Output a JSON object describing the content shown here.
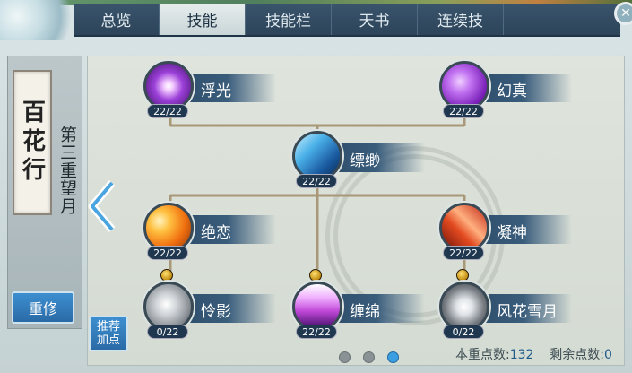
{
  "tabs": [
    {
      "label": "总览",
      "active": false
    },
    {
      "label": "技能",
      "active": true
    },
    {
      "label": "技能栏",
      "active": false
    },
    {
      "label": "天书",
      "active": false
    },
    {
      "label": "连续技",
      "active": false
    }
  ],
  "sect": {
    "name": "百花行",
    "stage": "第三重望月"
  },
  "buttons": {
    "reset": "重修",
    "recommend_line1": "推荐",
    "recommend_line2": "加点"
  },
  "skills": [
    {
      "name": "浮光",
      "count": "22/22",
      "color": "#9b3fd8"
    },
    {
      "name": "幻真",
      "count": "22/22",
      "color": "#a23fd8"
    },
    {
      "name": "缥缈",
      "count": "22/22",
      "color": "#3a8fd8"
    },
    {
      "name": "绝恋",
      "count": "22/22",
      "color": "#f09020"
    },
    {
      "name": "凝神",
      "count": "22/22",
      "color": "#e24a20"
    },
    {
      "name": "怜影",
      "count": "0/22",
      "color": "#b8bcc0"
    },
    {
      "name": "缠绵",
      "count": "22/22",
      "color": "#c048d8"
    },
    {
      "name": "风花雪月",
      "count": "0/22",
      "color": "#9ca2a8"
    }
  ],
  "stats": {
    "points_label": "本重点数:",
    "points_value": "132",
    "remaining_label": "剩余点数:",
    "remaining_value": "0"
  },
  "pagination": {
    "pages": 3,
    "current": 3
  }
}
